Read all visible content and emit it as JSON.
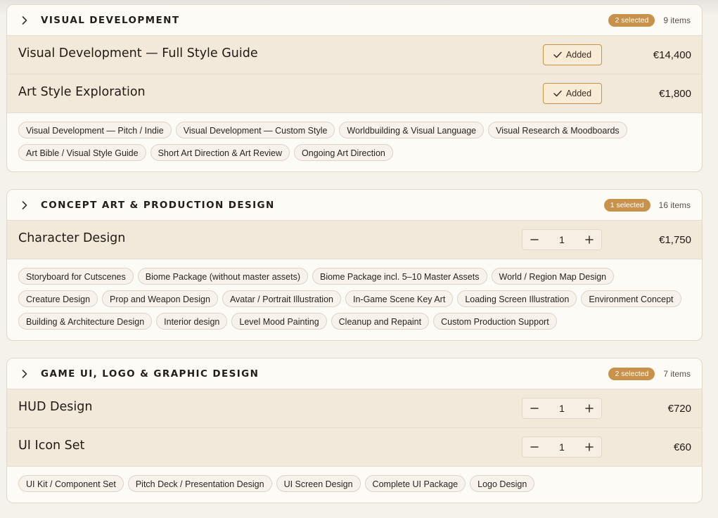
{
  "sections": [
    {
      "title": "VISUAL DEVELOPMENT",
      "selected_badge": "2 selected",
      "count": "9 items",
      "rows": [
        {
          "name": "Visual Development — Full Style Guide",
          "action": "Added",
          "price": "€14,400"
        },
        {
          "name": "Art Style Exploration",
          "action": "Added",
          "price": "€1,800"
        }
      ],
      "chips": [
        "Visual Development — Pitch / Indie",
        "Visual Development — Custom Style",
        "Worldbuilding & Visual Language",
        "Visual Research & Moodboards",
        "Art Bible / Visual Style Guide",
        "Short Art Direction & Art Review",
        "Ongoing Art Direction"
      ]
    },
    {
      "title": "CONCEPT ART & PRODUCTION DESIGN",
      "selected_badge": "1 selected",
      "count": "16 items",
      "rows": [
        {
          "name": "Character Design",
          "quantity": "1",
          "price": "€1,750"
        }
      ],
      "chips": [
        "Storyboard for Cutscenes",
        "Biome Package (without master assets)",
        "Biome Package incl. 5–10 Master Assets",
        "World / Region Map Design",
        "Creature Design",
        "Prop and Weapon Design",
        "Avatar / Portrait Illustration",
        "In-Game Scene Key Art",
        "Loading Screen Illustration",
        "Environment Concept",
        "Building & Architecture Design",
        "Interior design",
        "Level Mood Painting",
        "Cleanup and Repaint",
        "Custom Production Support"
      ]
    },
    {
      "title": "GAME UI, LOGO & GRAPHIC DESIGN",
      "selected_badge": "2 selected",
      "count": "7 items",
      "rows": [
        {
          "name": "HUD Design",
          "quantity": "1",
          "price": "€720"
        },
        {
          "name": "UI Icon Set",
          "quantity": "1",
          "price": "€60"
        }
      ],
      "chips": [
        "UI Kit / Component Set",
        "Pitch Deck / Presentation Design",
        "UI Screen Design",
        "Complete UI Package",
        "Logo Design"
      ]
    }
  ],
  "icons": {
    "chevron": "chevron-right-icon",
    "check": "check-icon",
    "minus": "minus-icon",
    "plus": "plus-icon"
  },
  "colors": {
    "accent": "#c8924a",
    "selected_row_bg": "#f3e9da",
    "card_bg": "#fdfbf6",
    "page_bg": "#f5f2ec"
  }
}
